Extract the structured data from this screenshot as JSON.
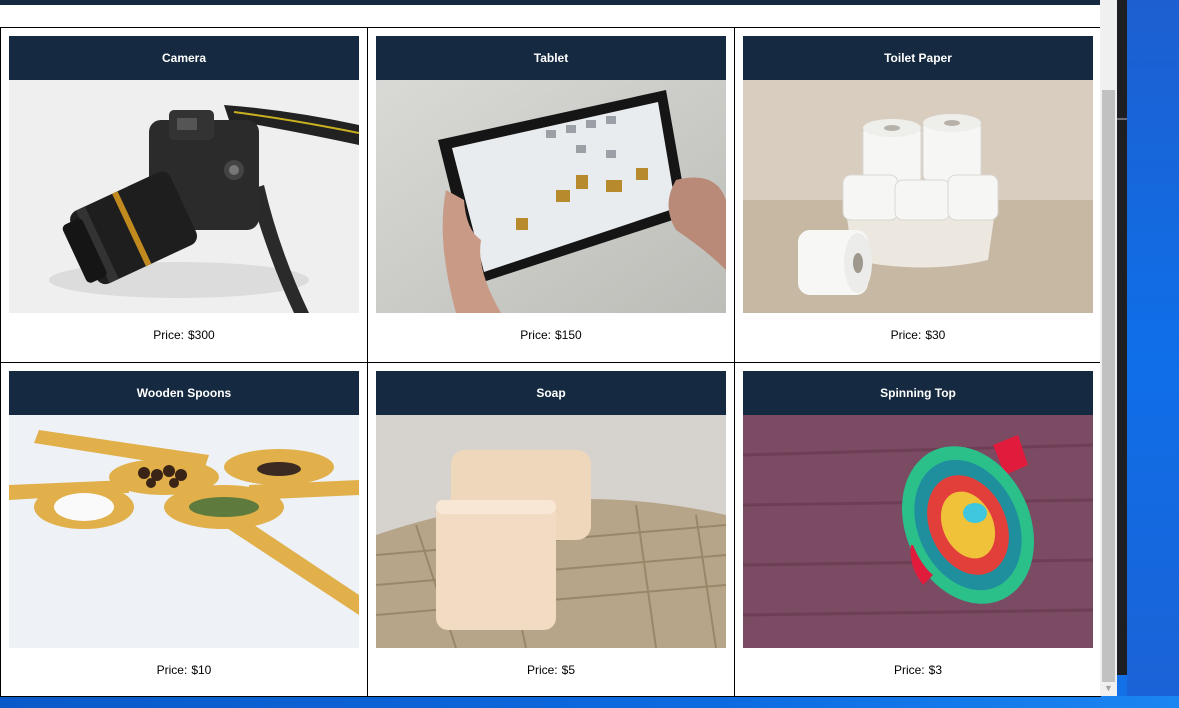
{
  "products": [
    {
      "name": "Camera",
      "price_label": "Price:",
      "price": "$300",
      "image_icon": "camera-photo"
    },
    {
      "name": "Tablet",
      "price_label": "Price:",
      "price": "$150",
      "image_icon": "tablet-photo"
    },
    {
      "name": "Toilet Paper",
      "price_label": "Price:",
      "price": "$30",
      "image_icon": "toilet-paper-photo"
    },
    {
      "name": "Wooden Spoons",
      "price_label": "Price:",
      "price": "$10",
      "image_icon": "wooden-spoons-photo"
    },
    {
      "name": "Soap",
      "price_label": "Price:",
      "price": "$5",
      "image_icon": "soap-photo"
    },
    {
      "name": "Spinning Top",
      "price_label": "Price:",
      "price": "$3",
      "image_icon": "spinning-top-photo"
    }
  ],
  "colors": {
    "header_bar": "#152a40",
    "card_border": "#000000",
    "page_bg": "#ffffff"
  }
}
